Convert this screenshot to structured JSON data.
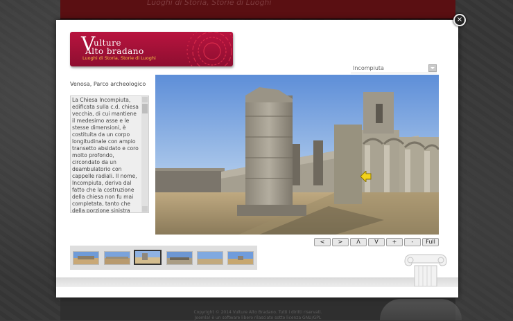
{
  "background": {
    "header_text": "Luoghi di Storia, Storie di Luoghi",
    "footer_lines": [
      "Copyright © 2014 Vulture Alto Bradano. Tutti i diritti riservati.",
      "Joomla! è un software libero rilasciato sotto licenza GNU/GPL"
    ]
  },
  "modal": {
    "close_label": "×",
    "logo": {
      "v_letter": "V",
      "line1": "ulture",
      "line2": "Alto bradano",
      "subtitle": "Luoghi di Storia, Storie di Luoghi",
      "colors": {
        "background": "#a8123a",
        "subtitle": "#f4c542"
      }
    },
    "scene_select": {
      "selected": "Incompiuta"
    },
    "place_title": "Venosa, Parco archeologico",
    "description": "La Chiesa Incompiuta, edificata sulla c.d. chiesa vecchia, di cui mantiene il medesimo asse e le stesse dimensioni, è costituita da un corpo longitudinale con ampio transetto absidato e coro molto profondo, circondato da un deambulatorio con cappelle radiali. Il nome, Incompiuta, deriva dal fatto che la costruzione della chiesa non fu mai completata, tanto che della porzione sinistra non furono realizzate né le fondazioni né la muratura",
    "controls": [
      {
        "id": "left",
        "label": "<"
      },
      {
        "id": "right",
        "label": ">"
      },
      {
        "id": "up",
        "label": "Λ"
      },
      {
        "id": "down",
        "label": "V"
      },
      {
        "id": "zoom_in",
        "label": "+"
      },
      {
        "id": "zoom_out",
        "label": "-"
      },
      {
        "id": "fullscreen",
        "label": "Full"
      }
    ],
    "thumbnails": [
      {
        "scene": "thumb-1",
        "active": false
      },
      {
        "scene": "thumb-2",
        "active": false
      },
      {
        "scene": "thumb-3",
        "active": true
      },
      {
        "scene": "thumb-4",
        "active": false
      },
      {
        "scene": "thumb-5",
        "active": false
      },
      {
        "scene": "thumb-6",
        "active": false
      }
    ]
  }
}
